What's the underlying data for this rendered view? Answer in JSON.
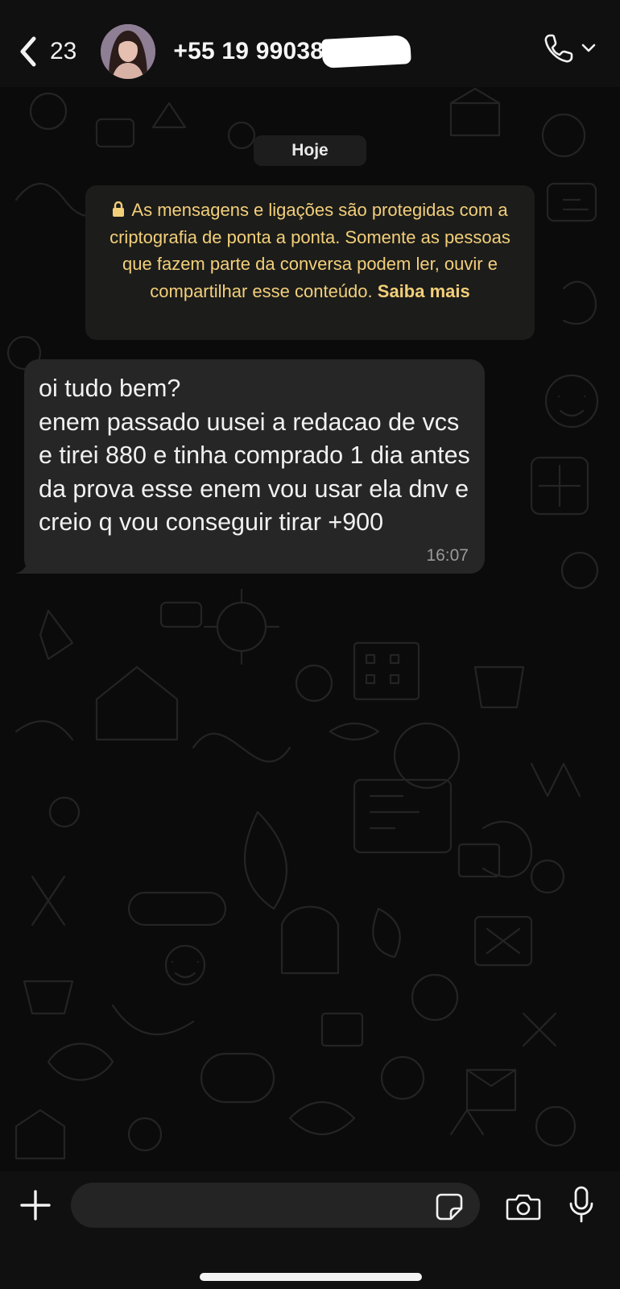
{
  "header": {
    "back_count": "23",
    "contact_name": "+55 19 99038"
  },
  "chat": {
    "date_label": "Hoje",
    "encryption_notice": "As mensagens e ligações são protegidas com a criptografia de ponta a ponta. Somente as pessoas que fazem parte da conversa podem ler, ouvir e compartilhar esse conteúdo.",
    "learn_more": "Saiba mais",
    "messages": [
      {
        "text": "oi tudo bem?\nenem passado uusei a redacao de vcs e tirei 880 e tinha comprado 1 dia antes da prova esse enem vou usar ela dnv e creio q vou conseguir tirar +900",
        "time": "16:07",
        "direction": "incoming"
      }
    ]
  },
  "composer": {
    "value": "",
    "placeholder": ""
  },
  "icons": [
    "back-chevron-icon",
    "phone-icon",
    "chevron-down-icon",
    "lock-icon",
    "plus-icon",
    "sticker-icon",
    "camera-icon",
    "microphone-icon"
  ],
  "colors": {
    "background": "#0b0b0b",
    "header": "#101010",
    "incoming_bubble": "#262626",
    "notice_bg": "#1c1c1a",
    "notice_text": "#f3cf7a",
    "timestamp": "#9a9a9a"
  }
}
